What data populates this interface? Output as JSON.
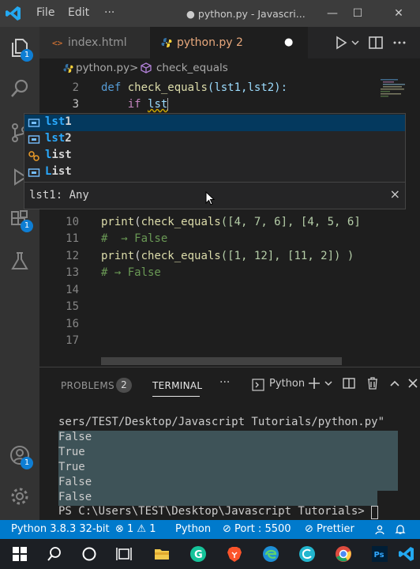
{
  "titlebar": {
    "menu": [
      "File",
      "Edit",
      "···"
    ],
    "title": "● python.py - Javascri...",
    "controls": {
      "minimize": "—",
      "maximize": "☐",
      "close": "✕"
    }
  },
  "activity": {
    "explorer_badge": "1",
    "extensions_badge": "1",
    "accounts_badge": "1"
  },
  "tabs": [
    {
      "label": "index.html",
      "active": false
    },
    {
      "label": "python.py 2",
      "active": true,
      "dirty": "●"
    }
  ],
  "breadcrumb": {
    "file": "python.py",
    "separator": ">",
    "symbol": "check_equals"
  },
  "editor": {
    "lines": [
      {
        "n": "2"
      },
      {
        "n": "3"
      },
      {
        "n": "10"
      },
      {
        "n": "11"
      },
      {
        "n": "12"
      },
      {
        "n": "13"
      },
      {
        "n": "14"
      },
      {
        "n": "15"
      },
      {
        "n": "16"
      },
      {
        "n": "17"
      }
    ],
    "code": {
      "l2_def": "def",
      "l2_name": "check_equals",
      "l2_params": "(lst1,lst2):",
      "l3_if": "if",
      "l3_typed": "lst",
      "l10_print": "print",
      "l10_paren": "(",
      "l10_call": "check_equals",
      "l10_args": "([4, 7, 6], [4, 5, 6]",
      "l11_comment": "#  → False",
      "l12_print": "print",
      "l12_paren": "(",
      "l12_call": "check_equals",
      "l12_args": "([1, 12], [11, 2]) )",
      "l13_comment": "# → False"
    }
  },
  "suggest": {
    "items": [
      {
        "match": "lst",
        "rest": "1",
        "kind": "variable"
      },
      {
        "match": "lst",
        "rest": "2",
        "kind": "variable"
      },
      {
        "match": "l",
        "rest": "ist",
        "kind": "class"
      },
      {
        "match": "L",
        "rest": "ist",
        "kind": "variable"
      }
    ],
    "detail": "lst1: Any",
    "close": "×"
  },
  "panel": {
    "tabs": {
      "problems": "PROBLEMS",
      "problems_count": "2",
      "terminal": "TERMINAL"
    },
    "more": "···",
    "terminal_select": "Python",
    "lines": [
      "sers/TEST/Desktop/Javascript Tutorials/python.py\"",
      "False",
      "True",
      "True",
      "False",
      "False",
      "PS C:\\Users\\TEST\\Desktop\\Javascript Tutorials> "
    ]
  },
  "status": {
    "python": "Python 3.8.3 32-bit",
    "problems": "⊗ 1 ⚠ 1",
    "language": "Python",
    "port": "⊘ Port : 5500",
    "prettier": "⊘ Prettier"
  }
}
